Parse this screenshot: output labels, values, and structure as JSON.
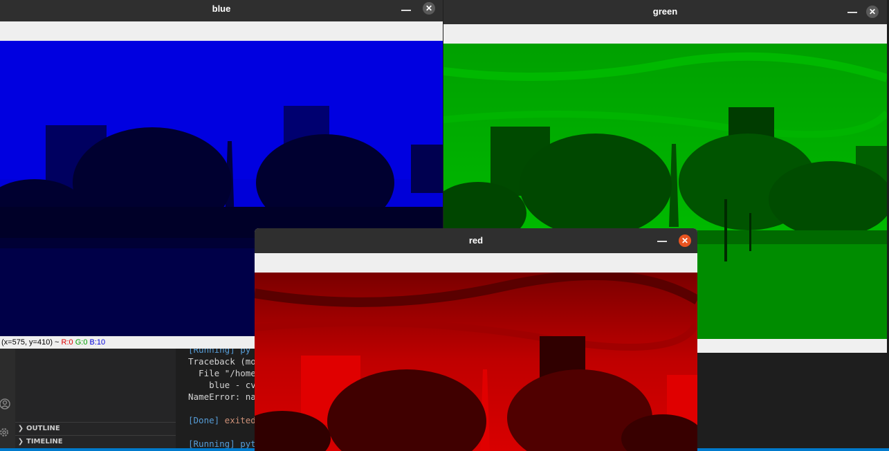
{
  "terminal": {
    "lines": [
      {
        "text": "[Running] py"
      },
      {
        "text": "Traceback (mo"
      },
      {
        "text": "  File \"/home"
      },
      {
        "text": "    blue - cv"
      },
      {
        "text": "NameError: na"
      },
      {
        "text": ""
      },
      {
        "text": "[Done] exited"
      },
      {
        "text": ""
      },
      {
        "text": "[Running] pyt"
      }
    ]
  },
  "sidebar": {
    "sections": [
      {
        "label": "OUTLINE"
      },
      {
        "label": "TIMELINE"
      }
    ]
  },
  "windows": {
    "blue": {
      "title": "blue",
      "status_coords": "(x=575, y=410) ~",
      "status_r": "R:0",
      "status_g": "G:0",
      "status_b": "B:10",
      "close_glyph": "✕"
    },
    "green": {
      "title": "green",
      "close_glyph": "✕"
    },
    "red": {
      "title": "red",
      "close_glyph": "✕"
    }
  },
  "colors": {
    "blue_channel": "#0000c8",
    "green_channel": "#00b400",
    "red_channel": "#c80000",
    "close_active": "#e95420",
    "close_inactive": "#5a5a5a",
    "vscode_accent": "#007acc"
  }
}
